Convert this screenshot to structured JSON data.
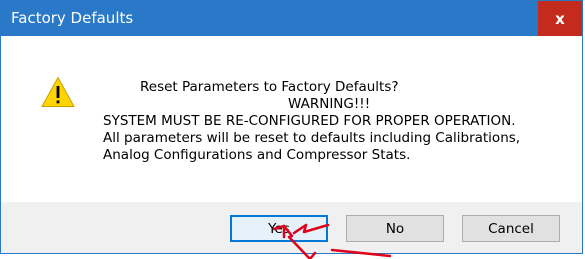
{
  "dialog": {
    "title": "Factory Defaults",
    "close_label": "x",
    "message_lines": {
      "l1": "Reset Parameters to Factory Defaults?",
      "l2": "WARNING!!!",
      "l3": "SYSTEM MUST BE RE-CONFIGURED FOR PROPER OPERATION.",
      "l4": "All parameters will be reset to defaults including Calibrations,",
      "l5": "Analog Configurations and Compressor Stats."
    },
    "icon": "warning-icon"
  },
  "buttons": {
    "yes": "Yes",
    "no": "No",
    "cancel": "Cancel"
  },
  "colors": {
    "titlebar": "#2a78c8",
    "close": "#c42b1c",
    "annotation": "#e0001a"
  }
}
